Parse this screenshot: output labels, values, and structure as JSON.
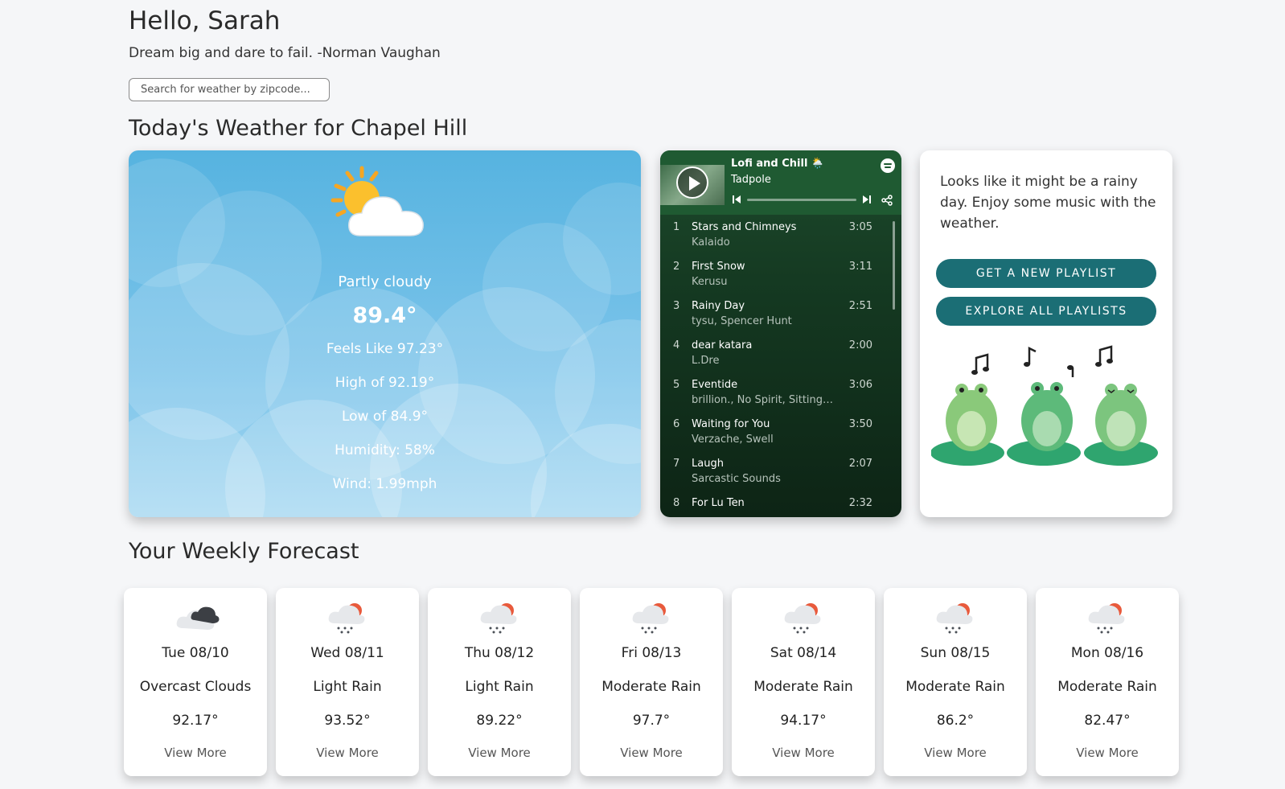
{
  "greeting": "Hello, Sarah",
  "quote": "Dream big and dare to fail. -Norman Vaughan",
  "search": {
    "placeholder": "Search for weather by zipcode..."
  },
  "today": {
    "title": "Today's Weather for Chapel Hill",
    "icon": "partly-cloudy-icon",
    "description": "Partly cloudy",
    "temperature": "89.4°",
    "feels_like": "Feels Like 97.23°",
    "high": "High of 92.19°",
    "low": "Low of 84.9°",
    "humidity": "Humidity: 58%",
    "wind": "Wind: 1.99mph"
  },
  "spotify": {
    "playlist": "Lofi and Chill 🌦️",
    "artist": "Tadpole",
    "tracks": [
      {
        "num": "1",
        "name": "Stars and Chimneys",
        "artist": "Kalaido",
        "duration": "3:05"
      },
      {
        "num": "2",
        "name": "First Snow",
        "artist": "Kerusu",
        "duration": "3:11"
      },
      {
        "num": "3",
        "name": "Rainy Day",
        "artist": "tysu, Spencer Hunt",
        "duration": "2:51"
      },
      {
        "num": "4",
        "name": "dear katara",
        "artist": "L.Dre",
        "duration": "2:00"
      },
      {
        "num": "5",
        "name": "Eventide",
        "artist": "brillion., No Spirit, Sitting Du...",
        "duration": "3:06"
      },
      {
        "num": "6",
        "name": "Waiting for You",
        "artist": "Verzache, Swell",
        "duration": "3:50"
      },
      {
        "num": "7",
        "name": "Laugh",
        "artist": "Sarcastic Sounds",
        "duration": "2:07"
      },
      {
        "num": "8",
        "name": "For Lu Ten",
        "artist": "",
        "duration": "2:32"
      }
    ]
  },
  "music": {
    "message": "Looks like it might be a rainy day. Enjoy some music with the weather.",
    "new_playlist_label": "GET A NEW PLAYLIST",
    "explore_label": "EXPLORE ALL PLAYLISTS"
  },
  "weekly": {
    "title": "Your Weekly Forecast",
    "days": [
      {
        "date": "Tue 08/10",
        "description": "Overcast Clouds",
        "temp": "92.17°",
        "more": "View More",
        "icon": "overcast-clouds-icon"
      },
      {
        "date": "Wed 08/11",
        "description": "Light Rain",
        "temp": "93.52°",
        "more": "View More",
        "icon": "rain-icon"
      },
      {
        "date": "Thu 08/12",
        "description": "Light Rain",
        "temp": "89.22°",
        "more": "View More",
        "icon": "rain-icon"
      },
      {
        "date": "Fri 08/13",
        "description": "Moderate Rain",
        "temp": "97.7°",
        "more": "View More",
        "icon": "rain-icon"
      },
      {
        "date": "Sat 08/14",
        "description": "Moderate Rain",
        "temp": "94.17°",
        "more": "View More",
        "icon": "rain-icon"
      },
      {
        "date": "Sun 08/15",
        "description": "Moderate Rain",
        "temp": "86.2°",
        "more": "View More",
        "icon": "rain-icon"
      },
      {
        "date": "Mon 08/16",
        "description": "Moderate Rain",
        "temp": "82.47°",
        "more": "View More",
        "icon": "rain-icon"
      }
    ]
  },
  "colors": {
    "accent": "#1b6e75",
    "spotify_bg": "#1f5a32",
    "sky": "#56b3e0"
  }
}
